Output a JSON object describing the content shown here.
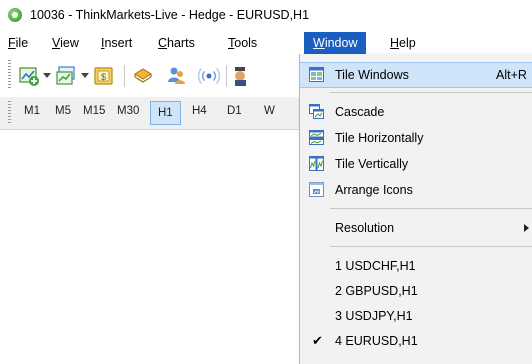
{
  "window": {
    "title": "10036 - ThinkMarkets-Live - Hedge - EURUSD,H1"
  },
  "menubar": {
    "file": {
      "first": "F",
      "rest": "ile"
    },
    "view": {
      "first": "V",
      "rest": "iew"
    },
    "insert": {
      "first": "I",
      "rest": "nsert"
    },
    "charts": {
      "first": "C",
      "rest": "harts"
    },
    "tools": {
      "first": "T",
      "rest": "ools"
    },
    "window": {
      "first": "W",
      "rest": "indow"
    },
    "help": {
      "first": "H",
      "rest": "elp"
    }
  },
  "toolbar": {
    "icons": [
      "new-chart-icon",
      "profiles-icon",
      "market-watch-icon",
      "metaeditor-icon",
      "navigator-icon",
      "signals-icon",
      "expert-icon"
    ]
  },
  "timeframes": {
    "items": [
      "M1",
      "M5",
      "M15",
      "M30",
      "H1",
      "H4",
      "D1",
      "W"
    ],
    "selected": "H1"
  },
  "window_menu": {
    "tile_windows": "Tile Windows",
    "tile_windows_shortcut": "Alt+R",
    "cascade": "Cascade",
    "tile_horizontally": "Tile Horizontally",
    "tile_vertically": "Tile Vertically",
    "arrange_icons": "Arrange Icons",
    "resolution": "Resolution",
    "windows": [
      "1 USDCHF,H1",
      "2 GBPUSD,H1",
      "3 USDJPY,H1",
      "4 EURUSD,H1"
    ],
    "checked_window": "4 EURUSD,H1",
    "check_mark": "✔"
  },
  "colors": {
    "menu_active": "#1b5ec2",
    "highlight": "#cfe3f9",
    "menu_background": "#f2f2f2"
  }
}
